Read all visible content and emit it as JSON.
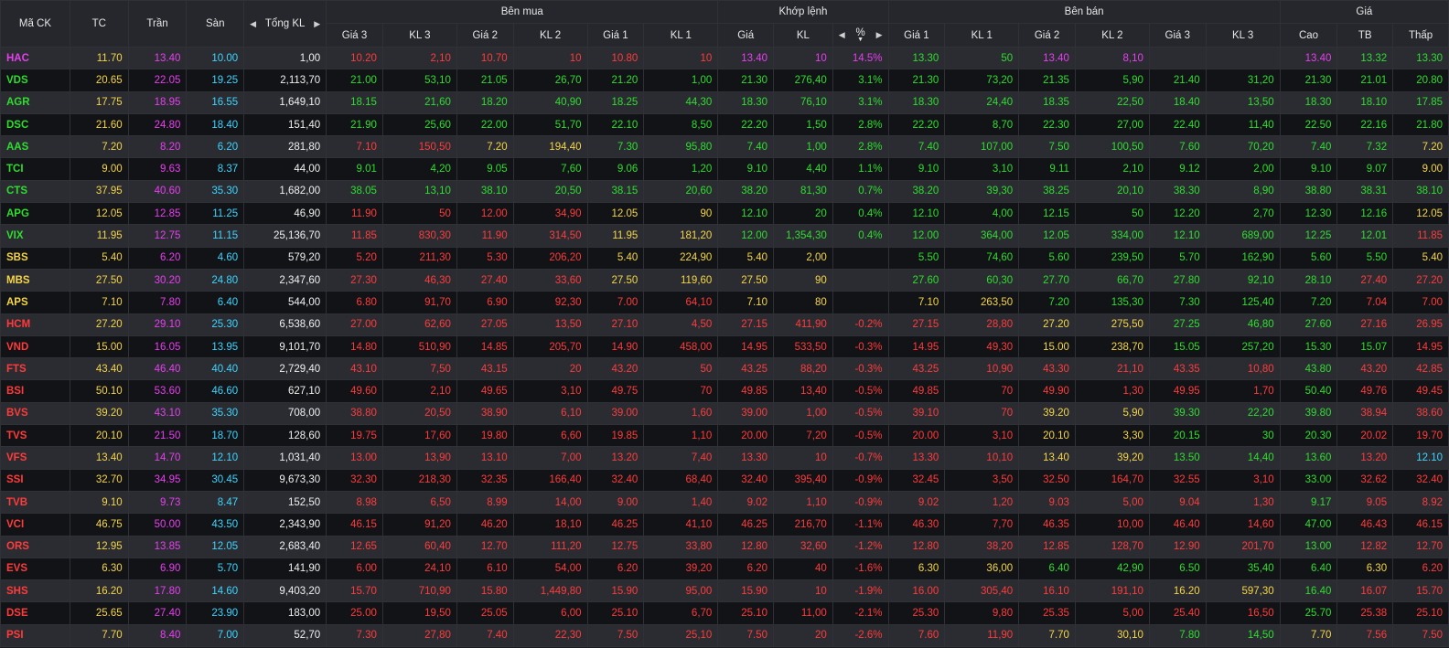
{
  "colors": {
    "ceil": "#e83ef0",
    "ref": "#f5d547",
    "floor": "#3dd5ff",
    "up": "#2fdd2f",
    "down": "#ff3b3b",
    "neutral": "#f0f0f0"
  },
  "headers": {
    "symbol": "Mã CK",
    "ref": "TC",
    "ceil": "Trần",
    "floor": "Sàn",
    "total_vol": "Tổng KL",
    "buy": "Bên mua",
    "match": "Khớp lệnh",
    "sell": "Bên bán",
    "price": "Giá",
    "buy_cols": [
      "Giá 3",
      "KL 3",
      "Giá 2",
      "KL 2",
      "Giá 1",
      "KL 1"
    ],
    "match_cols": [
      "Giá",
      "KL",
      "%"
    ],
    "sell_cols": [
      "Giá 1",
      "KL 1",
      "Giá 2",
      "KL 2",
      "Giá 3",
      "KL 3"
    ],
    "price_cols": [
      "Cao",
      "TB",
      "Thấp"
    ]
  },
  "rows": [
    {
      "sym": "HAC",
      "tc": "11.70",
      "tran": "13.40",
      "san": "10.00",
      "tkl": "1,00",
      "b3": "10.20",
      "bv3": "2,10",
      "b2": "10.70",
      "bv2": "10",
      "b1": "10.80",
      "bv1": "10",
      "mp": "13.40",
      "mv": "10",
      "pct": "14.5%",
      "s1": "13.30",
      "sv1": "50",
      "s2": "13.40",
      "sv2": "8,10",
      "s3": "",
      "sv3": "",
      "hi": "13.40",
      "avg": "13.32",
      "lo": "13.30"
    },
    {
      "sym": "VDS",
      "tc": "20.65",
      "tran": "22.05",
      "san": "19.25",
      "tkl": "2,113,70",
      "b3": "21.00",
      "bv3": "53,10",
      "b2": "21.05",
      "bv2": "26,70",
      "b1": "21.20",
      "bv1": "1,00",
      "mp": "21.30",
      "mv": "276,40",
      "pct": "3.1%",
      "s1": "21.30",
      "sv1": "73,20",
      "s2": "21.35",
      "sv2": "5,90",
      "s3": "21.40",
      "sv3": "31,20",
      "hi": "21.30",
      "avg": "21.01",
      "lo": "20.80"
    },
    {
      "sym": "AGR",
      "tc": "17.75",
      "tran": "18.95",
      "san": "16.55",
      "tkl": "1,649,10",
      "b3": "18.15",
      "bv3": "21,60",
      "b2": "18.20",
      "bv2": "40,90",
      "b1": "18.25",
      "bv1": "44,30",
      "mp": "18.30",
      "mv": "76,10",
      "pct": "3.1%",
      "s1": "18.30",
      "sv1": "24,40",
      "s2": "18.35",
      "sv2": "22,50",
      "s3": "18.40",
      "sv3": "13,50",
      "hi": "18.30",
      "avg": "18.10",
      "lo": "17.85"
    },
    {
      "sym": "DSC",
      "tc": "21.60",
      "tran": "24.80",
      "san": "18.40",
      "tkl": "151,40",
      "b3": "21.90",
      "bv3": "25,60",
      "b2": "22.00",
      "bv2": "51,70",
      "b1": "22.10",
      "bv1": "8,50",
      "mp": "22.20",
      "mv": "1,50",
      "pct": "2.8%",
      "s1": "22.20",
      "sv1": "8,70",
      "s2": "22.30",
      "sv2": "27,00",
      "s3": "22.40",
      "sv3": "11,40",
      "hi": "22.50",
      "avg": "22.16",
      "lo": "21.80"
    },
    {
      "sym": "AAS",
      "tc": "7.20",
      "tran": "8.20",
      "san": "6.20",
      "tkl": "281,80",
      "b3": "7.10",
      "bv3": "150,50",
      "b2": "7.20",
      "bv2": "194,40",
      "b1": "7.30",
      "bv1": "95,80",
      "mp": "7.40",
      "mv": "1,00",
      "pct": "2.8%",
      "s1": "7.40",
      "sv1": "107,00",
      "s2": "7.50",
      "sv2": "100,50",
      "s3": "7.60",
      "sv3": "70,20",
      "hi": "7.40",
      "avg": "7.32",
      "lo": "7.20"
    },
    {
      "sym": "TCI",
      "tc": "9.00",
      "tran": "9.63",
      "san": "8.37",
      "tkl": "44,00",
      "b3": "9.01",
      "bv3": "4,20",
      "b2": "9.05",
      "bv2": "7,60",
      "b1": "9.06",
      "bv1": "1,20",
      "mp": "9.10",
      "mv": "4,40",
      "pct": "1.1%",
      "s1": "9.10",
      "sv1": "3,10",
      "s2": "9.11",
      "sv2": "2,10",
      "s3": "9.12",
      "sv3": "2,00",
      "hi": "9.10",
      "avg": "9.07",
      "lo": "9.00"
    },
    {
      "sym": "CTS",
      "tc": "37.95",
      "tran": "40.60",
      "san": "35.30",
      "tkl": "1,682,00",
      "b3": "38.05",
      "bv3": "13,10",
      "b2": "38.10",
      "bv2": "20,50",
      "b1": "38.15",
      "bv1": "20,60",
      "mp": "38.20",
      "mv": "81,30",
      "pct": "0.7%",
      "s1": "38.20",
      "sv1": "39,30",
      "s2": "38.25",
      "sv2": "20,10",
      "s3": "38.30",
      "sv3": "8,90",
      "hi": "38.80",
      "avg": "38.31",
      "lo": "38.10"
    },
    {
      "sym": "APG",
      "tc": "12.05",
      "tran": "12.85",
      "san": "11.25",
      "tkl": "46,90",
      "b3": "11.90",
      "bv3": "50",
      "b2": "12.00",
      "bv2": "34,90",
      "b1": "12.05",
      "bv1": "90",
      "mp": "12.10",
      "mv": "20",
      "pct": "0.4%",
      "s1": "12.10",
      "sv1": "4,00",
      "s2": "12.15",
      "sv2": "50",
      "s3": "12.20",
      "sv3": "2,70",
      "hi": "12.30",
      "avg": "12.16",
      "lo": "12.05"
    },
    {
      "sym": "VIX",
      "tc": "11.95",
      "tran": "12.75",
      "san": "11.15",
      "tkl": "25,136,70",
      "b3": "11.85",
      "bv3": "830,30",
      "b2": "11.90",
      "bv2": "314,50",
      "b1": "11.95",
      "bv1": "181,20",
      "mp": "12.00",
      "mv": "1,354,30",
      "pct": "0.4%",
      "s1": "12.00",
      "sv1": "364,00",
      "s2": "12.05",
      "sv2": "334,00",
      "s3": "12.10",
      "sv3": "689,00",
      "hi": "12.25",
      "avg": "12.01",
      "lo": "11.85"
    },
    {
      "sym": "SBS",
      "tc": "5.40",
      "tran": "6.20",
      "san": "4.60",
      "tkl": "579,20",
      "b3": "5.20",
      "bv3": "211,30",
      "b2": "5.30",
      "bv2": "206,20",
      "b1": "5.40",
      "bv1": "224,90",
      "mp": "5.40",
      "mv": "2,00",
      "pct": "",
      "s1": "5.50",
      "sv1": "74,60",
      "s2": "5.60",
      "sv2": "239,50",
      "s3": "5.70",
      "sv3": "162,90",
      "hi": "5.60",
      "avg": "5.50",
      "lo": "5.40"
    },
    {
      "sym": "MBS",
      "tc": "27.50",
      "tran": "30.20",
      "san": "24.80",
      "tkl": "2,347,60",
      "b3": "27.30",
      "bv3": "46,30",
      "b2": "27.40",
      "bv2": "33,60",
      "b1": "27.50",
      "bv1": "119,60",
      "mp": "27.50",
      "mv": "90",
      "pct": "",
      "s1": "27.60",
      "sv1": "60,30",
      "s2": "27.70",
      "sv2": "66,70",
      "s3": "27.80",
      "sv3": "92,10",
      "hi": "28.10",
      "avg": "27.40",
      "lo": "27.20"
    },
    {
      "sym": "APS",
      "tc": "7.10",
      "tran": "7.80",
      "san": "6.40",
      "tkl": "544,00",
      "b3": "6.80",
      "bv3": "91,70",
      "b2": "6.90",
      "bv2": "92,30",
      "b1": "7.00",
      "bv1": "64,10",
      "mp": "7.10",
      "mv": "80",
      "pct": "",
      "s1": "7.10",
      "sv1": "263,50",
      "s2": "7.20",
      "sv2": "135,30",
      "s3": "7.30",
      "sv3": "125,40",
      "hi": "7.20",
      "avg": "7.04",
      "lo": "7.00"
    },
    {
      "sym": "HCM",
      "tc": "27.20",
      "tran": "29.10",
      "san": "25.30",
      "tkl": "6,538,60",
      "b3": "27.00",
      "bv3": "62,60",
      "b2": "27.05",
      "bv2": "13,50",
      "b1": "27.10",
      "bv1": "4,50",
      "mp": "27.15",
      "mv": "411,90",
      "pct": "-0.2%",
      "s1": "27.15",
      "sv1": "28,80",
      "s2": "27.20",
      "sv2": "275,50",
      "s3": "27.25",
      "sv3": "46,80",
      "hi": "27.60",
      "avg": "27.16",
      "lo": "26.95"
    },
    {
      "sym": "VND",
      "tc": "15.00",
      "tran": "16.05",
      "san": "13.95",
      "tkl": "9,101,70",
      "b3": "14.80",
      "bv3": "510,90",
      "b2": "14.85",
      "bv2": "205,70",
      "b1": "14.90",
      "bv1": "458,00",
      "mp": "14.95",
      "mv": "533,50",
      "pct": "-0.3%",
      "s1": "14.95",
      "sv1": "49,30",
      "s2": "15.00",
      "sv2": "238,70",
      "s3": "15.05",
      "sv3": "257,20",
      "hi": "15.30",
      "avg": "15.07",
      "lo": "14.95"
    },
    {
      "sym": "FTS",
      "tc": "43.40",
      "tran": "46.40",
      "san": "40.40",
      "tkl": "2,729,40",
      "b3": "43.10",
      "bv3": "7,50",
      "b2": "43.15",
      "bv2": "20",
      "b1": "43.20",
      "bv1": "50",
      "mp": "43.25",
      "mv": "88,20",
      "pct": "-0.3%",
      "s1": "43.25",
      "sv1": "10,90",
      "s2": "43.30",
      "sv2": "21,10",
      "s3": "43.35",
      "sv3": "10,80",
      "hi": "43.80",
      "avg": "43.20",
      "lo": "42.85"
    },
    {
      "sym": "BSI",
      "tc": "50.10",
      "tran": "53.60",
      "san": "46.60",
      "tkl": "627,10",
      "b3": "49.60",
      "bv3": "2,10",
      "b2": "49.65",
      "bv2": "3,10",
      "b1": "49.75",
      "bv1": "70",
      "mp": "49.85",
      "mv": "13,40",
      "pct": "-0.5%",
      "s1": "49.85",
      "sv1": "70",
      "s2": "49.90",
      "sv2": "1,30",
      "s3": "49.95",
      "sv3": "1,70",
      "hi": "50.40",
      "avg": "49.76",
      "lo": "49.45"
    },
    {
      "sym": "BVS",
      "tc": "39.20",
      "tran": "43.10",
      "san": "35.30",
      "tkl": "708,00",
      "b3": "38.80",
      "bv3": "20,50",
      "b2": "38.90",
      "bv2": "6,10",
      "b1": "39.00",
      "bv1": "1,60",
      "mp": "39.00",
      "mv": "1,00",
      "pct": "-0.5%",
      "s1": "39.10",
      "sv1": "70",
      "s2": "39.20",
      "sv2": "5,90",
      "s3": "39.30",
      "sv3": "22,20",
      "hi": "39.80",
      "avg": "38.94",
      "lo": "38.60"
    },
    {
      "sym": "TVS",
      "tc": "20.10",
      "tran": "21.50",
      "san": "18.70",
      "tkl": "128,60",
      "b3": "19.75",
      "bv3": "17,60",
      "b2": "19.80",
      "bv2": "6,60",
      "b1": "19.85",
      "bv1": "1,10",
      "mp": "20.00",
      "mv": "7,20",
      "pct": "-0.5%",
      "s1": "20.00",
      "sv1": "3,10",
      "s2": "20.10",
      "sv2": "3,30",
      "s3": "20.15",
      "sv3": "30",
      "hi": "20.30",
      "avg": "20.02",
      "lo": "19.70"
    },
    {
      "sym": "VFS",
      "tc": "13.40",
      "tran": "14.70",
      "san": "12.10",
      "tkl": "1,031,40",
      "b3": "13.00",
      "bv3": "13,90",
      "b2": "13.10",
      "bv2": "7,00",
      "b1": "13.20",
      "bv1": "7,40",
      "mp": "13.30",
      "mv": "10",
      "pct": "-0.7%",
      "s1": "13.30",
      "sv1": "10,10",
      "s2": "13.40",
      "sv2": "39,20",
      "s3": "13.50",
      "sv3": "14,40",
      "hi": "13.60",
      "avg": "13.20",
      "lo": "12.10"
    },
    {
      "sym": "SSI",
      "tc": "32.70",
      "tran": "34.95",
      "san": "30.45",
      "tkl": "9,673,30",
      "b3": "32.30",
      "bv3": "218,30",
      "b2": "32.35",
      "bv2": "166,40",
      "b1": "32.40",
      "bv1": "68,40",
      "mp": "32.40",
      "mv": "395,40",
      "pct": "-0.9%",
      "s1": "32.45",
      "sv1": "3,50",
      "s2": "32.50",
      "sv2": "164,70",
      "s3": "32.55",
      "sv3": "3,10",
      "hi": "33.00",
      "avg": "32.62",
      "lo": "32.40"
    },
    {
      "sym": "TVB",
      "tc": "9.10",
      "tran": "9.73",
      "san": "8.47",
      "tkl": "152,50",
      "b3": "8.98",
      "bv3": "6,50",
      "b2": "8.99",
      "bv2": "14,00",
      "b1": "9.00",
      "bv1": "1,40",
      "mp": "9.02",
      "mv": "1,10",
      "pct": "-0.9%",
      "s1": "9.02",
      "sv1": "1,20",
      "s2": "9.03",
      "sv2": "5,00",
      "s3": "9.04",
      "sv3": "1,30",
      "hi": "9.17",
      "avg": "9.05",
      "lo": "8.92"
    },
    {
      "sym": "VCI",
      "tc": "46.75",
      "tran": "50.00",
      "san": "43.50",
      "tkl": "2,343,90",
      "b3": "46.15",
      "bv3": "91,20",
      "b2": "46.20",
      "bv2": "18,10",
      "b1": "46.25",
      "bv1": "41,10",
      "mp": "46.25",
      "mv": "216,70",
      "pct": "-1.1%",
      "s1": "46.30",
      "sv1": "7,70",
      "s2": "46.35",
      "sv2": "10,00",
      "s3": "46.40",
      "sv3": "14,60",
      "hi": "47.00",
      "avg": "46.43",
      "lo": "46.15"
    },
    {
      "sym": "ORS",
      "tc": "12.95",
      "tran": "13.85",
      "san": "12.05",
      "tkl": "2,683,40",
      "b3": "12.65",
      "bv3": "60,40",
      "b2": "12.70",
      "bv2": "111,20",
      "b1": "12.75",
      "bv1": "33,80",
      "mp": "12.80",
      "mv": "32,60",
      "pct": "-1.2%",
      "s1": "12.80",
      "sv1": "38,20",
      "s2": "12.85",
      "sv2": "128,70",
      "s3": "12.90",
      "sv3": "201,70",
      "hi": "13.00",
      "avg": "12.82",
      "lo": "12.70"
    },
    {
      "sym": "EVS",
      "tc": "6.30",
      "tran": "6.90",
      "san": "5.70",
      "tkl": "141,90",
      "b3": "6.00",
      "bv3": "24,10",
      "b2": "6.10",
      "bv2": "54,00",
      "b1": "6.20",
      "bv1": "39,20",
      "mp": "6.20",
      "mv": "40",
      "pct": "-1.6%",
      "s1": "6.30",
      "sv1": "36,00",
      "s2": "6.40",
      "sv2": "42,90",
      "s3": "6.50",
      "sv3": "35,40",
      "hi": "6.40",
      "avg": "6.30",
      "lo": "6.20"
    },
    {
      "sym": "SHS",
      "tc": "16.20",
      "tran": "17.80",
      "san": "14.60",
      "tkl": "9,403,20",
      "b3": "15.70",
      "bv3": "710,90",
      "b2": "15.80",
      "bv2": "1,449,80",
      "b1": "15.90",
      "bv1": "95,00",
      "mp": "15.90",
      "mv": "10",
      "pct": "-1.9%",
      "s1": "16.00",
      "sv1": "305,40",
      "s2": "16.10",
      "sv2": "191,10",
      "s3": "16.20",
      "sv3": "597,30",
      "hi": "16.40",
      "avg": "16.07",
      "lo": "15.70"
    },
    {
      "sym": "DSE",
      "tc": "25.65",
      "tran": "27.40",
      "san": "23.90",
      "tkl": "183,00",
      "b3": "25.00",
      "bv3": "19,50",
      "b2": "25.05",
      "bv2": "6,00",
      "b1": "25.10",
      "bv1": "6,70",
      "mp": "25.10",
      "mv": "11,00",
      "pct": "-2.1%",
      "s1": "25.30",
      "sv1": "9,80",
      "s2": "25.35",
      "sv2": "5,00",
      "s3": "25.40",
      "sv3": "16,50",
      "hi": "25.70",
      "avg": "25.38",
      "lo": "25.10"
    },
    {
      "sym": "PSI",
      "tc": "7.70",
      "tran": "8.40",
      "san": "7.00",
      "tkl": "52,70",
      "b3": "7.30",
      "bv3": "27,80",
      "b2": "7.40",
      "bv2": "22,30",
      "b1": "7.50",
      "bv1": "25,10",
      "mp": "7.50",
      "mv": "20",
      "pct": "-2.6%",
      "s1": "7.60",
      "sv1": "11,90",
      "s2": "7.70",
      "sv2": "30,10",
      "s3": "7.80",
      "sv3": "14,50",
      "hi": "7.70",
      "avg": "7.56",
      "lo": "7.50"
    }
  ]
}
